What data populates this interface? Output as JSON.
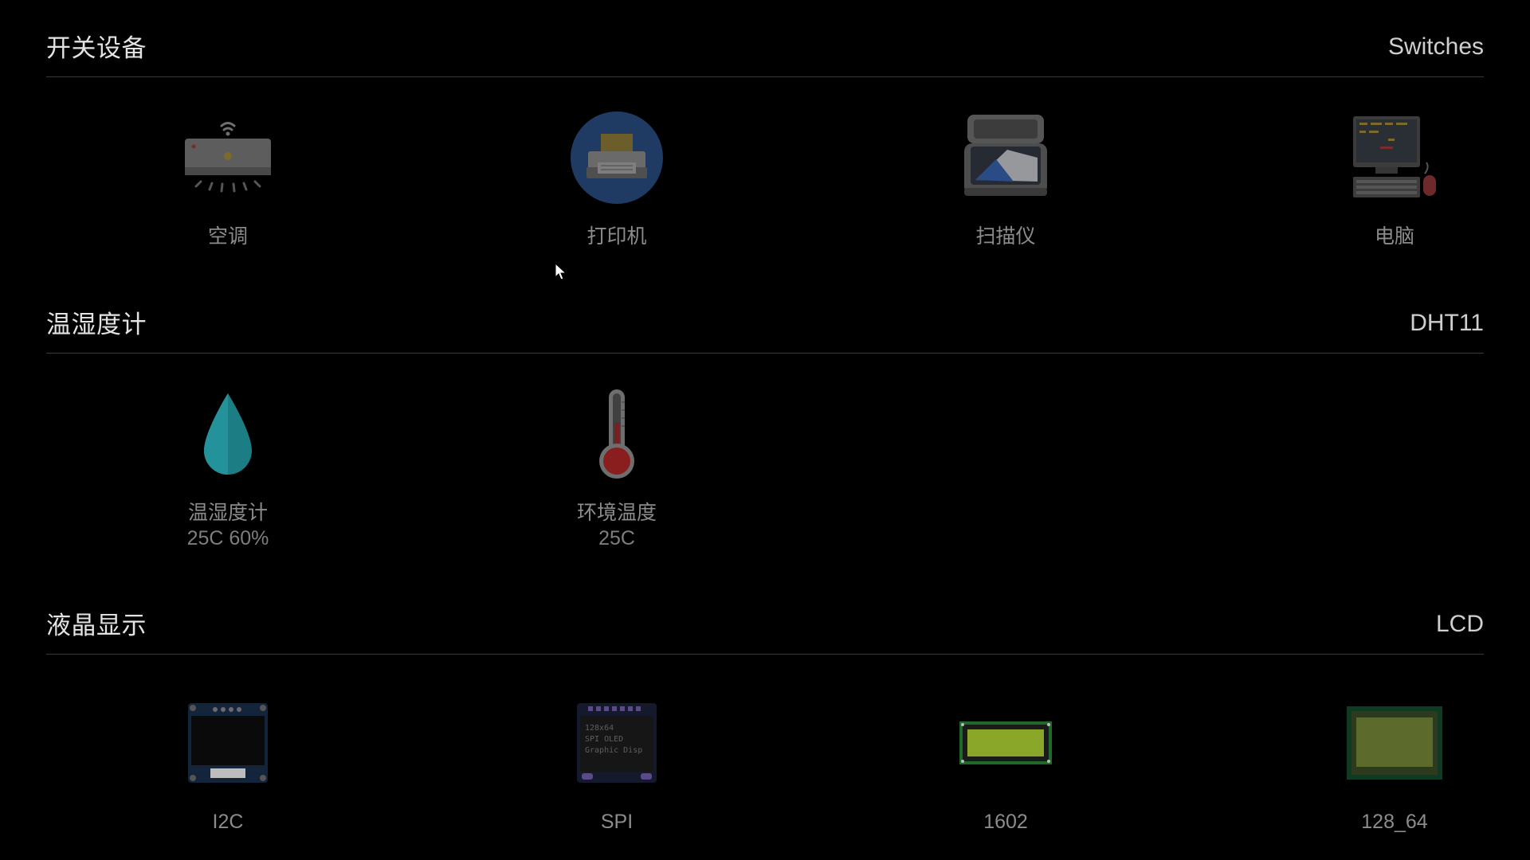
{
  "sections": [
    {
      "title": "开关设备",
      "tag": "Switches",
      "items": [
        {
          "label": "空调",
          "icon": "air-conditioner-icon"
        },
        {
          "label": "打印机",
          "icon": "printer-icon"
        },
        {
          "label": "扫描仪",
          "icon": "scanner-icon"
        },
        {
          "label": "电脑",
          "icon": "computer-icon"
        }
      ]
    },
    {
      "title": "温湿度计",
      "tag": "DHT11",
      "items": [
        {
          "label": "温湿度计",
          "value": "25C 60%",
          "icon": "water-drop-icon"
        },
        {
          "label": "环境温度",
          "value": "25C",
          "icon": "thermometer-icon"
        }
      ]
    },
    {
      "title": "液晶显示",
      "tag": "LCD",
      "items": [
        {
          "label": "I2C",
          "icon": "oled-i2c-module-icon"
        },
        {
          "label": "SPI",
          "icon": "oled-spi-module-icon"
        },
        {
          "label": "1602",
          "icon": "lcd-1602-module-icon"
        },
        {
          "label": "128_64",
          "icon": "lcd-128x64-module-icon"
        }
      ]
    }
  ],
  "spi_module_text": [
    "128x64",
    "SPI OLED",
    "Graphic Disp"
  ],
  "colors": {
    "background": "#000000",
    "title": "#e3e3e3",
    "label": "#8c8c8c",
    "divider": "#3a3a3a"
  }
}
